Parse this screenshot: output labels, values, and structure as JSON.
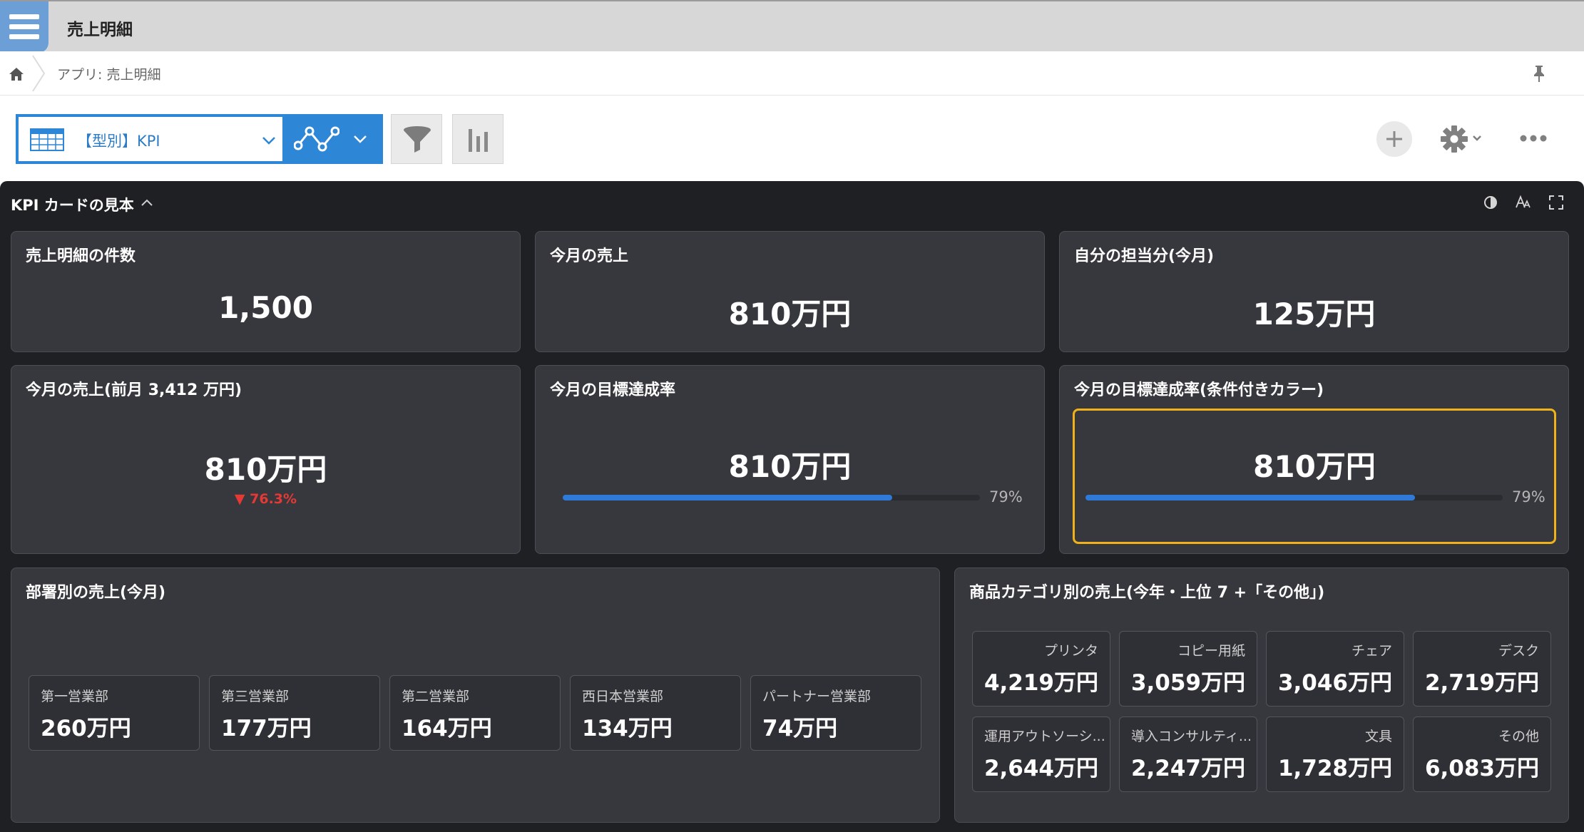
{
  "app": {
    "title": "売上明細"
  },
  "breadcrumb": {
    "text": "アプリ: 売上明細"
  },
  "toolbar": {
    "view_label": "【型別】KPI"
  },
  "dashboard": {
    "title": "KPI カードの見本",
    "kpi_cards": [
      {
        "title": "売上明細の件数",
        "value": "1,500"
      },
      {
        "title": "今月の売上",
        "value": "810万円"
      },
      {
        "title": "自分の担当分(今月)",
        "value": "125万円"
      },
      {
        "title": "今月の売上(前月 3,412 万円)",
        "value": "810万円",
        "delta": "▼ 76.3%"
      },
      {
        "title": "今月の目標達成率",
        "value": "810万円",
        "progress": 0.79,
        "progress_label": "79%"
      },
      {
        "title": "今月の目標達成率(条件付きカラー)",
        "value": "810万円",
        "progress": 0.79,
        "progress_label": "79%",
        "highlight_color": "#f0b21a"
      }
    ],
    "dept": {
      "title": "部署別の売上(今月)",
      "items": [
        {
          "label": "第一営業部",
          "value": "260万円"
        },
        {
          "label": "第三営業部",
          "value": "177万円"
        },
        {
          "label": "第二営業部",
          "value": "164万円"
        },
        {
          "label": "西日本営業部",
          "value": "134万円"
        },
        {
          "label": "パートナー営業部",
          "value": "74万円"
        }
      ]
    },
    "category": {
      "title": "商品カテゴリ別の売上(今年・上位 7 +「その他」)",
      "items": [
        {
          "label": "プリンタ",
          "value": "4,219万円"
        },
        {
          "label": "コピー用紙",
          "value": "3,059万円"
        },
        {
          "label": "チェア",
          "value": "3,046万円"
        },
        {
          "label": "デスク",
          "value": "2,719万円"
        },
        {
          "label": "運用アウトソーシ...",
          "value": "2,644万円"
        },
        {
          "label": "導入コンサルティ...",
          "value": "2,247万円"
        },
        {
          "label": "文具",
          "value": "1,728万円"
        },
        {
          "label": "その他",
          "value": "6,083万円"
        }
      ]
    }
  },
  "colors": {
    "accent": "#2d86d6",
    "dashboard_bg": "#1f2024",
    "card_bg": "#37383d",
    "progress": "#2f7ad8",
    "negative": "#e53935"
  },
  "icons": [
    "menu-icon",
    "home-icon",
    "pin-icon",
    "table-icon",
    "chevron-down-icon",
    "graph-icon",
    "filter-icon",
    "bar-chart-icon",
    "plus-icon",
    "gear-icon",
    "more-icon",
    "contrast-icon",
    "font-size-icon",
    "fullscreen-icon",
    "chevron-up-icon"
  ]
}
